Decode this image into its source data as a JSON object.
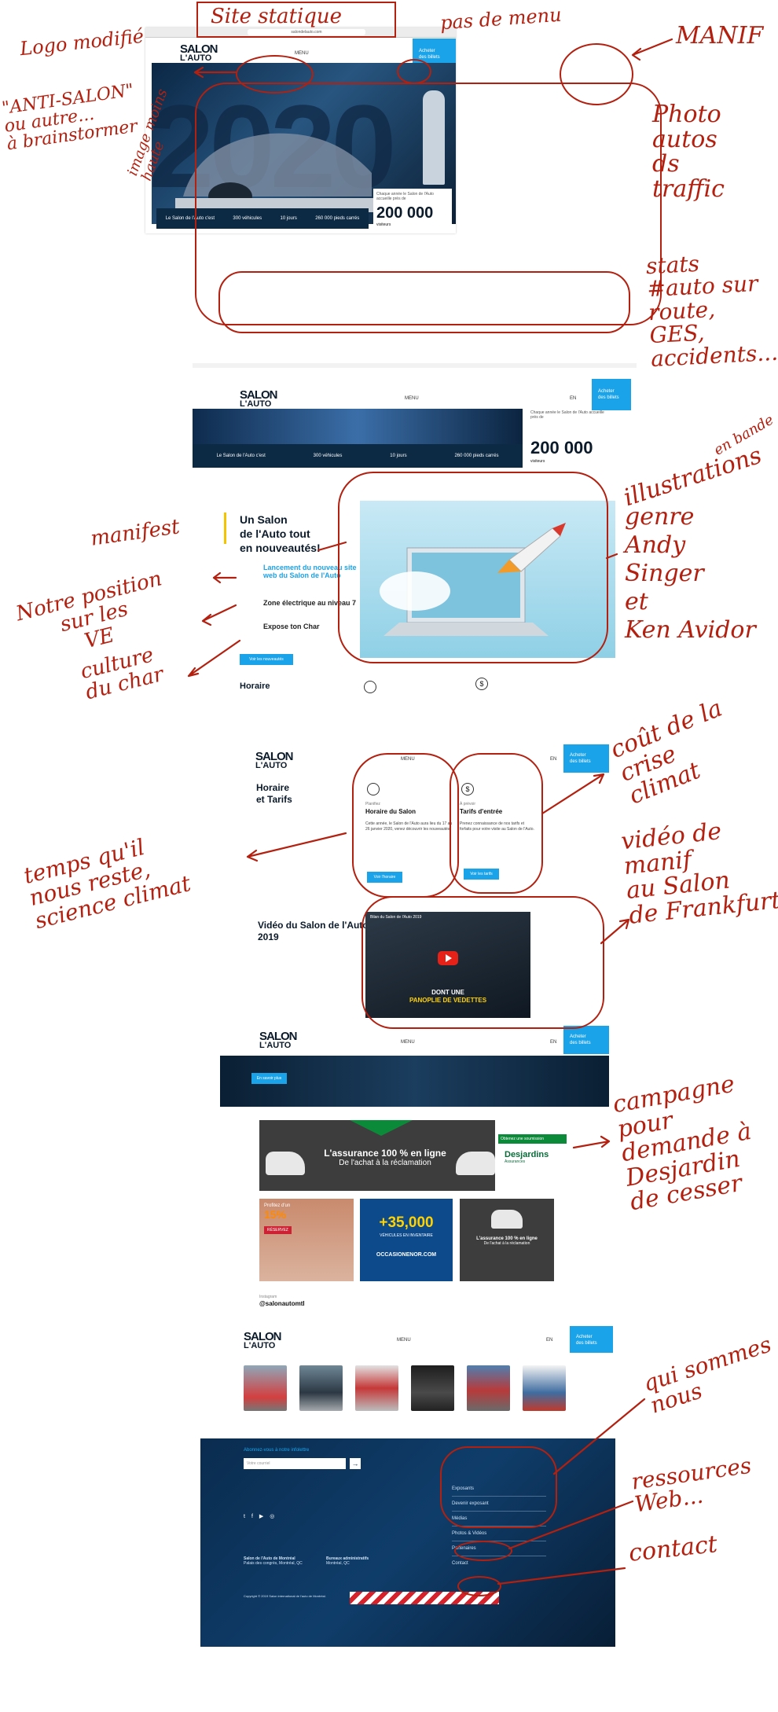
{
  "annotations": {
    "site_statique": "Site statique",
    "logo_modifie": "Logo modifié",
    "pas_de_menu": "pas de menu",
    "manif": "MANIF",
    "anti_salon_1": "\"ANTI-SALON\"",
    "anti_salon_2": "ou autre...",
    "anti_salon_3": "à brainstormer",
    "image_moins_haute_1": "image moins",
    "image_moins_haute_2": "haute",
    "photo_1": "Photo",
    "photo_2": "autos",
    "photo_3": "ds",
    "photo_4": "traffic",
    "stats_1": "stats",
    "stats_2": "#auto sur",
    "stats_3": "route,",
    "stats_4": "GES,",
    "stats_5": "accidents...",
    "illustrations_1": "illustrations",
    "illustrations_2": "en bande",
    "illustrations_3": "genre",
    "illustrations_4": "Andy",
    "illustrations_5": "Singer",
    "illustrations_6": "et",
    "illustrations_7": "Ken Avidor",
    "manifest": "manifest",
    "notre_position_1": "Notre position",
    "notre_position_2": "sur les",
    "notre_position_3": "VE",
    "culture_1": "culture",
    "culture_2": "du char",
    "cout_1": "coût de la",
    "cout_2": "crise",
    "cout_3": "climat",
    "temps_1": "temps qu'il",
    "temps_2": "nous reste,",
    "temps_3": "science climat",
    "video_1": "vidéo de",
    "video_2": "manif",
    "video_3": "au Salon",
    "video_4": "de Frankfurt",
    "campagne_1": "campagne",
    "campagne_2": "pour",
    "campagne_3": "demande à",
    "campagne_4": "Desjardin",
    "campagne_5": "de cesser",
    "qui_1": "qui sommes",
    "qui_2": "nous",
    "ressources_1": "ressources",
    "ressources_2": "Web...",
    "contact": "contact"
  },
  "site": {
    "url": "salondelauto.com",
    "logo_line1": "SALON",
    "logo_line2": "L'AUTO",
    "menu_label": "MENU",
    "lang": "EN",
    "cta_line1": "Acheter",
    "cta_line2": "des billets",
    "hero_year": "2020",
    "stats": [
      "Le Salon de l'Auto c'est",
      "300 véhicules",
      "10 jours",
      "260 000 pieds carrés"
    ],
    "visitors_caption": "Chaque année le Salon de l'Auto accueille près de",
    "visitors_number": "200 000",
    "visitors_unit": "visiteurs",
    "news_title_1": "Un Salon",
    "news_title_2": "de l'Auto tout",
    "news_title_3": "en nouveautés!",
    "news_items": [
      "Lancement du nouveau site web du Salon de l'Auto",
      "Zone électrique au niveau 7",
      "Expose ton Char"
    ],
    "news_button": "Voir les nouveautés",
    "horaire_heading": "Horaire",
    "horaire_tarifs_1": "Horaire",
    "horaire_tarifs_2": "et Tarifs",
    "card1_kicker": "Planifiez",
    "card1_title": "Horaire du Salon",
    "card1_text": "Cette année, le Salon de l'Auto aura lieu du 17 au 26 janvier 2020, venez découvrir les nouveautés.",
    "card1_button": "Voir l'horaire",
    "card2_kicker": "À prévoir",
    "card2_title": "Tarifs d'entrée",
    "card2_text": "Prenez connaissance de nos tarifs et forfaits pour votre visite au Salon de l'Auto.",
    "card2_button": "Voir les tarifs",
    "video_title_1": "Vidéo du Salon de l'Auto",
    "video_title_2": "2019",
    "video_overlay_title": "Bilan du Salon de l'Auto 2019",
    "video_caption_1": "DONT UNE",
    "video_caption_2": "PANOPLIE DE VEDETTES",
    "banner_button": "En savoir plus",
    "ad1_line1": "L'assurance 100 % en ligne",
    "ad1_line2": "De l'achat à la réclamation",
    "ad1_brand": "Desjardins",
    "ad1_sub": "Assurances",
    "ad1_cta": "Obtenez une soumission",
    "ad2_kicker": "Profitez d'un",
    "ad2_percent": "15%",
    "ad2_button": "RÉSERVEZ",
    "ad3_number": "+35,000",
    "ad3_sub": "VÉHICULES EN INVENTAIRE",
    "ad3_url": "OCCASIONENOR.COM",
    "ad4_line1": "L'assurance 100 % en ligne",
    "ad4_line2": "De l'achat à la réclamation",
    "instagram_label": "Instagram",
    "instagram_handle": "@salonautomtl",
    "footer_newsletter": "Abonnez-vous à notre infolettre",
    "footer_input_placeholder": "Votre courriel",
    "footer_links": [
      "Exposants",
      "Devenir exposant",
      "Médias",
      "Photos & Vidéos",
      "Partenaires",
      "Contact"
    ],
    "footer_col1_title": "Salon de l'Auto de Montréal",
    "footer_col1_addr": "Palais des congrès, Montréal, QC",
    "footer_col2_title": "Bureaux administratifs",
    "footer_col2_addr": "Montréal, QC",
    "copyright": "Copyright © 2019 Salon international de l'auto de Montréal."
  },
  "colors": {
    "annotation_red": "#b3200f",
    "brand_blue": "#1aa3e8",
    "dark_navy": "#0c2a44",
    "desjardins_green": "#0b8a3a"
  }
}
